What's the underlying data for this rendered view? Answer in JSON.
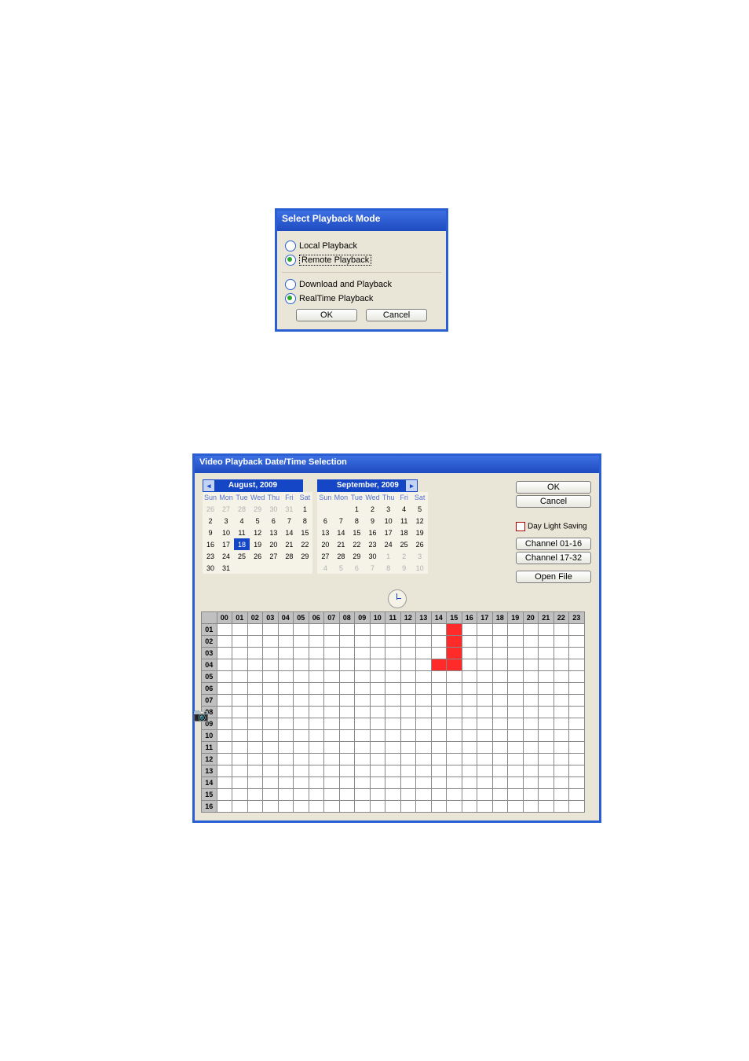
{
  "dialog1": {
    "title": "Select Playback Mode",
    "opt_local": "Local Playback",
    "opt_remote": "Remote Playback",
    "opt_download": "Download and Playback",
    "opt_realtime": "RealTime Playback",
    "ok": "OK",
    "cancel": "Cancel",
    "selected_source": "remote",
    "selected_mode": "realtime"
  },
  "dialog2": {
    "title": "Video Playback Date/Time Selection",
    "ok": "OK",
    "cancel": "Cancel",
    "daylight": "Day Light Saving",
    "daylight_checked": false,
    "ch_a": "Channel 01-16",
    "ch_b": "Channel 17-32",
    "openfile": "Open File",
    "cal_left": {
      "label": "August, 2009",
      "dow": [
        "Sun",
        "Mon",
        "Tue",
        "Wed",
        "Thu",
        "Fri",
        "Sat"
      ],
      "weeks": [
        [
          {
            "d": 26,
            "dim": 1
          },
          {
            "d": 27,
            "dim": 1
          },
          {
            "d": 28,
            "dim": 1
          },
          {
            "d": 29,
            "dim": 1
          },
          {
            "d": 30,
            "dim": 1
          },
          {
            "d": 31,
            "dim": 1
          },
          {
            "d": 1
          }
        ],
        [
          {
            "d": 2
          },
          {
            "d": 3
          },
          {
            "d": 4
          },
          {
            "d": 5
          },
          {
            "d": 6
          },
          {
            "d": 7
          },
          {
            "d": 8
          }
        ],
        [
          {
            "d": 9
          },
          {
            "d": 10
          },
          {
            "d": 11
          },
          {
            "d": 12
          },
          {
            "d": 13
          },
          {
            "d": 14
          },
          {
            "d": 15
          }
        ],
        [
          {
            "d": 16
          },
          {
            "d": 17
          },
          {
            "d": 18,
            "sel": 1
          },
          {
            "d": 19
          },
          {
            "d": 20
          },
          {
            "d": 21
          },
          {
            "d": 22
          }
        ],
        [
          {
            "d": 23
          },
          {
            "d": 24
          },
          {
            "d": 25
          },
          {
            "d": 26
          },
          {
            "d": 27
          },
          {
            "d": 28
          },
          {
            "d": 29
          }
        ],
        [
          {
            "d": 30
          },
          {
            "d": 31
          },
          {
            "d": ""
          },
          {
            "d": ""
          },
          {
            "d": ""
          },
          {
            "d": ""
          },
          {
            "d": ""
          }
        ]
      ]
    },
    "cal_right": {
      "label": "September, 2009",
      "dow": [
        "Sun",
        "Mon",
        "Tue",
        "Wed",
        "Thu",
        "Fri",
        "Sat"
      ],
      "weeks": [
        [
          {
            "d": ""
          },
          {
            "d": ""
          },
          {
            "d": 1
          },
          {
            "d": 2
          },
          {
            "d": 3
          },
          {
            "d": 4
          },
          {
            "d": 5
          }
        ],
        [
          {
            "d": 6
          },
          {
            "d": 7
          },
          {
            "d": 8
          },
          {
            "d": 9
          },
          {
            "d": 10
          },
          {
            "d": 11
          },
          {
            "d": 12
          }
        ],
        [
          {
            "d": 13
          },
          {
            "d": 14
          },
          {
            "d": 15
          },
          {
            "d": 16
          },
          {
            "d": 17
          },
          {
            "d": 18
          },
          {
            "d": 19
          }
        ],
        [
          {
            "d": 20
          },
          {
            "d": 21
          },
          {
            "d": 22
          },
          {
            "d": 23
          },
          {
            "d": 24
          },
          {
            "d": 25
          },
          {
            "d": 26
          }
        ],
        [
          {
            "d": 27
          },
          {
            "d": 28
          },
          {
            "d": 29
          },
          {
            "d": 30
          },
          {
            "d": 1,
            "dim": 1
          },
          {
            "d": 2,
            "dim": 1
          },
          {
            "d": 3,
            "dim": 1
          }
        ],
        [
          {
            "d": 4,
            "dim": 1
          },
          {
            "d": 5,
            "dim": 1
          },
          {
            "d": 6,
            "dim": 1
          },
          {
            "d": 7,
            "dim": 1
          },
          {
            "d": 8,
            "dim": 1
          },
          {
            "d": 9,
            "dim": 1
          },
          {
            "d": 10,
            "dim": 1
          }
        ]
      ]
    },
    "hours": [
      "00",
      "01",
      "02",
      "03",
      "04",
      "05",
      "06",
      "07",
      "08",
      "09",
      "10",
      "11",
      "12",
      "13",
      "14",
      "15",
      "16",
      "17",
      "18",
      "19",
      "20",
      "21",
      "22",
      "23"
    ],
    "channels": [
      "01",
      "02",
      "03",
      "04",
      "05",
      "06",
      "07",
      "08",
      "09",
      "10",
      "11",
      "12",
      "13",
      "14",
      "15",
      "16"
    ],
    "recordings": [
      {
        "ch": "01",
        "h": "15"
      },
      {
        "ch": "02",
        "h": "15"
      },
      {
        "ch": "03",
        "h": "15"
      },
      {
        "ch": "04",
        "h": "14"
      },
      {
        "ch": "04",
        "h": "15"
      }
    ]
  }
}
